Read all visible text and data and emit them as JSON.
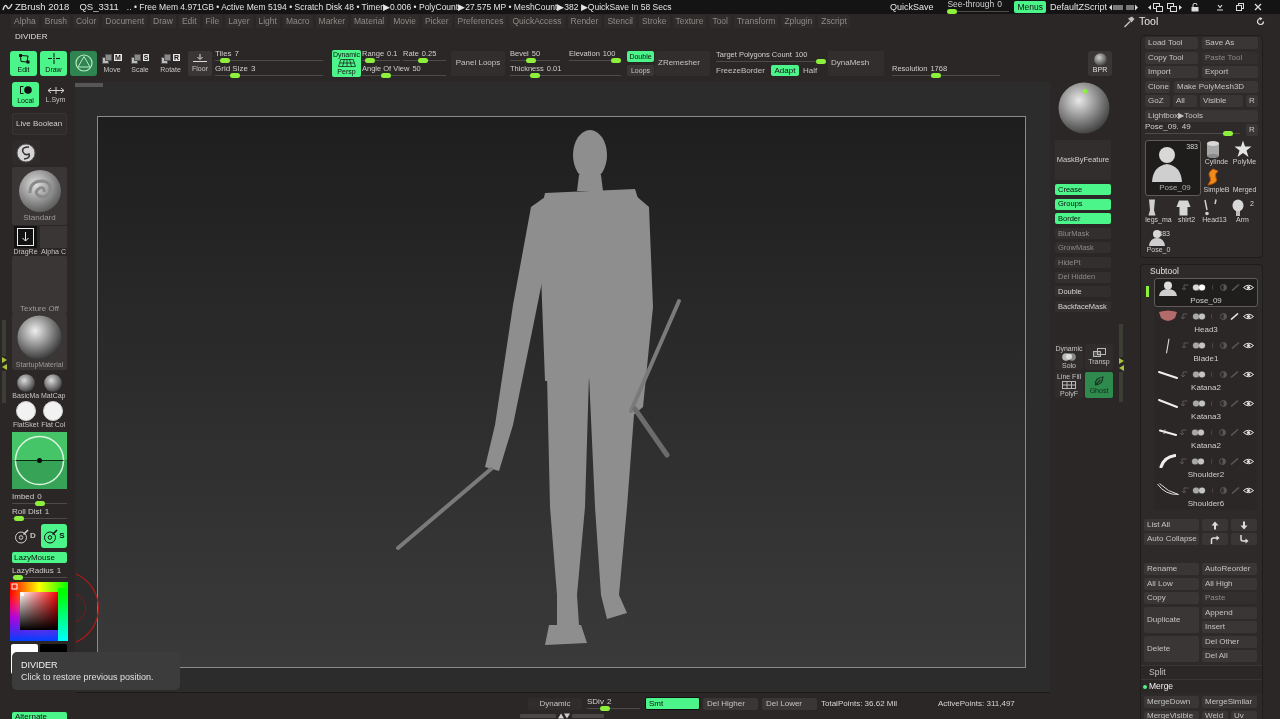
{
  "title_bar": {
    "app": "ZBrush 2018",
    "document": "QS_3311",
    "stats": ".. • Free Mem 4.971GB • Active Mem 5194 • Scratch Disk 48 • Timer▶0.006 • PolyCount▶27.575 MP • MeshCount▶382 ▶QuickSave In 58 Secs",
    "quicksave": "QuickSave",
    "see_through": {
      "label": "See-through",
      "value": "0",
      "level": 0
    },
    "menus": {
      "label": "Menus",
      "on": true
    },
    "script": "DefaultZScript"
  },
  "menu_bar": [
    "Alpha",
    "Brush",
    "Color",
    "Document",
    "Draw",
    "Edit",
    "File",
    "Layer",
    "Light",
    "Macro",
    "Marker",
    "Material",
    "Movie",
    "Picker",
    "Preferences",
    "QuickAccess",
    "Render",
    "Stencil",
    "Stroke",
    "Texture",
    "Tool",
    "Transform",
    "Zplugin",
    "Zscript"
  ],
  "shelf_label": "DIVIDER",
  "top_shelf": {
    "modes": [
      {
        "label": "Edit",
        "on": true
      },
      {
        "label": "Draw",
        "on": true
      }
    ],
    "sculptris_pro": {
      "on": true
    },
    "transforms": [
      {
        "key": "M",
        "label": "Move",
        "on": false
      },
      {
        "key": "S",
        "label": "Scale",
        "on": false
      },
      {
        "key": "R",
        "label": "Rotate",
        "on": false
      }
    ],
    "floor": {
      "label": "Floor",
      "on": false
    },
    "grid_sliders": [
      {
        "label": "Tiles",
        "value": "7",
        "level": 0.05
      },
      {
        "label": "Grid Size",
        "value": "3",
        "level": 0.15
      }
    ],
    "persp": {
      "caption": "Dynamic",
      "label": "Persp",
      "on": true
    },
    "range": {
      "label": "Range",
      "value": "0.1",
      "level": 0.1
    },
    "rate": {
      "label": "Rate",
      "value": "0.25",
      "level": 0.45
    },
    "angle_of_view": {
      "label": "Angle Of View",
      "value": "50",
      "level": 0.25
    },
    "panel_loops": "Panel Loops",
    "bevel": {
      "label": "Bevel",
      "value": "50",
      "level": 0.4
    },
    "elevation": {
      "label": "Elevation",
      "value": "100",
      "level": 1
    },
    "thickness": {
      "label": "Thickness",
      "value": "0.01",
      "level": 0.2
    },
    "double": {
      "label": "Double",
      "on": true
    },
    "loops": {
      "label": "Loops",
      "on": false
    },
    "zremesher": "ZRemesher",
    "target_polygons": {
      "label": "Target Polygons Count",
      "value": "100",
      "level": 1
    },
    "freeze_border": {
      "label": "FreezeBorder",
      "on": false
    },
    "adapt": {
      "label": "Adapt",
      "on": true
    },
    "half": {
      "label": "Half",
      "on": false
    },
    "dynamesh": "DynaMesh",
    "resolution": {
      "label": "Resolution",
      "value": "1768",
      "level": 0.4
    },
    "bpr": "BPR"
  },
  "left_tray": {
    "local": {
      "label": "Local",
      "on": true
    },
    "lsym": {
      "label": "L.Sym",
      "on": false
    },
    "live_boolean": {
      "label": "Live Boolean",
      "on": false
    },
    "brush": "Standard",
    "stroke": "DragRe",
    "alpha": "Alpha C",
    "texture": "Texture Off",
    "material": "StartupMaterial",
    "materials": [
      {
        "label": "BasicMa",
        "kind": "shaded"
      },
      {
        "label": "MatCap",
        "kind": "shaded"
      },
      {
        "label": "FlatSket",
        "kind": "flat"
      },
      {
        "label": "Flat Col",
        "kind": "flat"
      }
    ],
    "imbed": {
      "label": "Imbed",
      "value": "0",
      "level": 0.5
    },
    "roll_dist": {
      "label": "Roll Dist",
      "value": "1",
      "level": 0.05
    },
    "draw_modes": [
      {
        "key": "D",
        "on": false
      },
      {
        "key": "S",
        "on": true
      }
    ],
    "lazy_mouse": {
      "label": "LazyMouse",
      "on": true
    },
    "lazy_radius": {
      "label": "LazyRadius",
      "value": "1",
      "level": 0.03
    },
    "swatches": [
      {
        "color": "#ffffff"
      },
      {
        "color": "#000000"
      }
    ],
    "alternate": {
      "label": "Alternate",
      "on": true
    }
  },
  "tooltip": {
    "title": "DIVIDER",
    "text": "Click to restore previous position."
  },
  "right_shelf": {
    "mask_by_feature": "MaskByFeature",
    "mask_options": [
      {
        "label": "Crease",
        "on": true
      },
      {
        "label": "Groups",
        "on": true
      },
      {
        "label": "Border",
        "on": true
      }
    ],
    "actions": [
      {
        "label": "BlurMask",
        "disabled": true
      },
      {
        "label": "GrowMask",
        "disabled": true
      },
      {
        "label": "HidePt",
        "disabled": true
      },
      {
        "label": "Del Hidden",
        "disabled": true
      },
      {
        "label": "Double",
        "disabled": false
      },
      {
        "label": "BackfaceMask",
        "disabled": false
      }
    ],
    "display": [
      {
        "caption": "Dynamic",
        "label": "Solo",
        "on": false
      },
      {
        "label": "Transp",
        "on": false
      },
      {
        "caption": "Line Fill",
        "label": "PolyF",
        "on": false
      },
      {
        "label": "Ghost",
        "on": true
      }
    ]
  },
  "bottom_shelf": {
    "dynamic": "Dynamic",
    "sdiv": {
      "label": "SDiv",
      "value": "2",
      "level": 0.3
    },
    "smt": {
      "label": "Smt",
      "on": true
    },
    "del_higher": "Del Higher",
    "del_lower": "Del Lower",
    "total_points": "TotalPoints: 36.62 Mil",
    "active_points": "ActivePoints: 311,497"
  },
  "tool_palette": {
    "title": "Tool",
    "file_buttons": [
      {
        "label": "Load Tool",
        "disabled": false
      },
      {
        "label": "Save As",
        "disabled": false
      },
      {
        "label": "Copy Tool",
        "disabled": false
      },
      {
        "label": "Paste Tool",
        "disabled": true
      },
      {
        "label": "Import",
        "disabled": false
      },
      {
        "label": "Export",
        "disabled": false
      }
    ],
    "clone": "Clone",
    "make_polymesh": "Make PolyMesh3D",
    "goz": [
      "GoZ",
      "All",
      "Visible",
      "R"
    ],
    "lightbox": "Lightbox▶Tools",
    "current_tool": {
      "label": "Pose_09.",
      "value": "49",
      "level": 0.92
    },
    "current_tool_reset": "R",
    "tools": [
      {
        "label": "Pose_09",
        "count": "383",
        "selected": true
      },
      {
        "label": "Cylinde",
        "selected": false
      },
      {
        "label": "PolyMe",
        "selected": false
      },
      {
        "label": "SimpleB",
        "selected": false
      },
      {
        "label": "Merged",
        "selected": false
      },
      {
        "label": "legs_ma",
        "selected": false
      },
      {
        "label": "shirt2",
        "selected": false
      },
      {
        "label": "Head13",
        "selected": false
      },
      {
        "label": "Arm",
        "count": "2",
        "selected": false
      },
      {
        "label": "Pose_0",
        "count": "383",
        "selected": false
      }
    ]
  },
  "subtool": {
    "title": "Subtool",
    "items": [
      {
        "name": "Pose_09",
        "selected": true,
        "polypaint": false,
        "visible": true
      },
      {
        "name": "Head3",
        "selected": false,
        "polypaint": true,
        "visible": true
      },
      {
        "name": "Blade1",
        "selected": false,
        "polypaint": false,
        "visible": true
      },
      {
        "name": "Katana2",
        "selected": false,
        "polypaint": false,
        "visible": true
      },
      {
        "name": "Katana3",
        "selected": false,
        "polypaint": false,
        "visible": true
      },
      {
        "name": "Katana2",
        "selected": false,
        "polypaint": false,
        "visible": true
      },
      {
        "name": "Shoulder2",
        "selected": false,
        "polypaint": false,
        "visible": true
      },
      {
        "name": "Shoulder6",
        "selected": false,
        "polypaint": false,
        "visible": true
      }
    ],
    "list_all": "List All",
    "auto_collapse": "Auto Collapse",
    "actions": [
      {
        "label": "Rename",
        "disabled": false
      },
      {
        "label": "AutoReorder",
        "disabled": false
      },
      {
        "label": "All Low",
        "disabled": false
      },
      {
        "label": "All High",
        "disabled": false
      },
      {
        "label": "Copy",
        "disabled": false
      },
      {
        "label": "Paste",
        "disabled": true
      }
    ],
    "duplicate": {
      "label": "Duplicate",
      "options": [
        "Append",
        "Insert"
      ]
    },
    "delete": {
      "label": "Delete",
      "options": [
        "Del Other",
        "Del All"
      ]
    },
    "sections": [
      {
        "label": "Split",
        "expanded": false
      },
      {
        "label": "Merge",
        "expanded": true
      }
    ],
    "merge_buttons": [
      "MergeDown",
      "MergeSimilar"
    ],
    "merge_more": [
      "MergeVisible",
      "Weld",
      "Uv"
    ]
  }
}
